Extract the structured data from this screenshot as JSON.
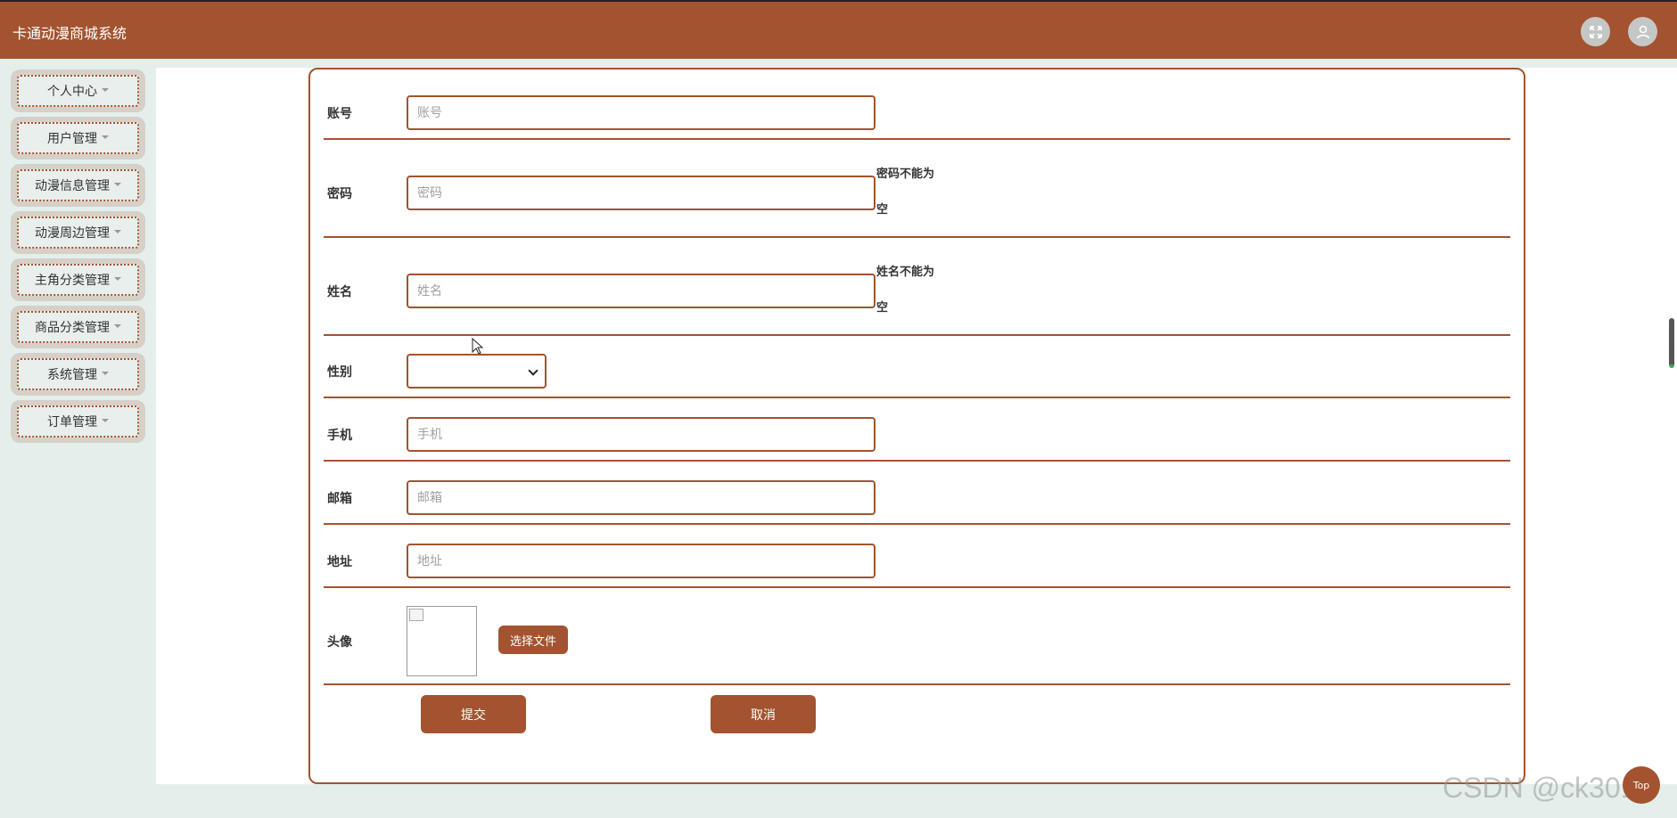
{
  "header": {
    "title": "卡通动漫商城系统",
    "fullscreen_icon": "fullscreen-icon",
    "user_icon": "user-icon"
  },
  "sidebar": {
    "items": [
      {
        "label": "个人中心"
      },
      {
        "label": "用户管理"
      },
      {
        "label": "动漫信息管理"
      },
      {
        "label": "动漫周边管理"
      },
      {
        "label": "主角分类管理"
      },
      {
        "label": "商品分类管理"
      },
      {
        "label": "系统管理"
      },
      {
        "label": "订单管理"
      }
    ]
  },
  "form": {
    "account": {
      "label": "账号",
      "placeholder": "账号"
    },
    "password": {
      "label": "密码",
      "placeholder": "密码",
      "error": "密码不能为空"
    },
    "name": {
      "label": "姓名",
      "placeholder": "姓名",
      "error": "姓名不能为空"
    },
    "gender": {
      "label": "性别",
      "value": ""
    },
    "phone": {
      "label": "手机",
      "placeholder": "手机"
    },
    "email": {
      "label": "邮箱",
      "placeholder": "邮箱"
    },
    "address": {
      "label": "地址",
      "placeholder": "地址"
    },
    "avatar": {
      "label": "头像",
      "choose_file": "选择文件"
    },
    "submit": "提交",
    "cancel": "取消"
  },
  "back_to_top": "Top",
  "watermark": "CSDN @ck3018",
  "colors": {
    "primary": "#a3532f",
    "page_bg": "#e4efec"
  }
}
